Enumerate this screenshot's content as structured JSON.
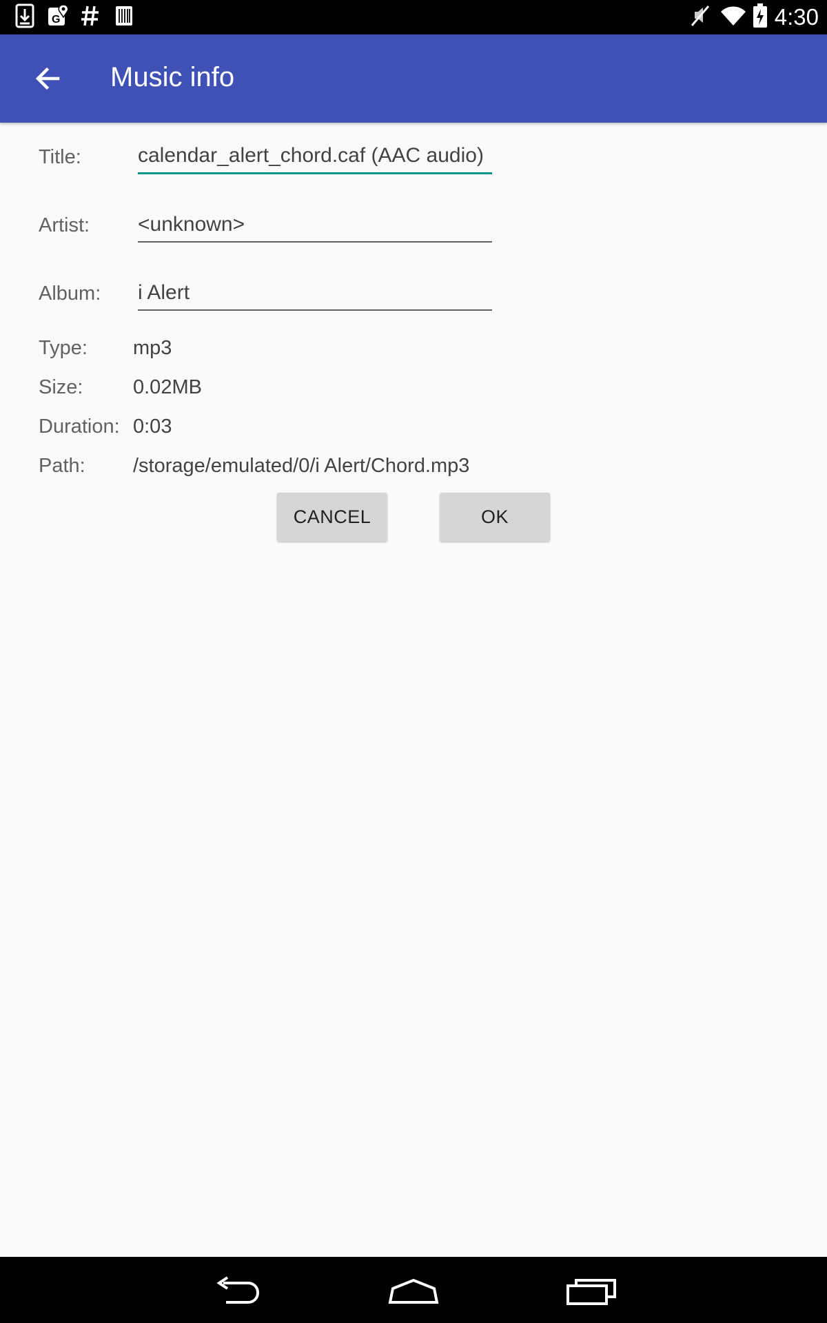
{
  "status_bar": {
    "time": "4:30",
    "left_icons": [
      "download-icon",
      "maps-icon",
      "hashtag-icon",
      "barcode-icon"
    ],
    "right_icons": [
      "mute-icon",
      "wifi-icon",
      "battery-charging-icon"
    ]
  },
  "app_bar": {
    "title": "Music info",
    "background": "#3f51b5"
  },
  "form": {
    "title": {
      "label": "Title:",
      "value": "calendar_alert_chord.caf (AAC audio)"
    },
    "artist": {
      "label": "Artist:",
      "value": "<unknown>"
    },
    "album": {
      "label": "Album:",
      "value": "i Alert"
    }
  },
  "info": {
    "type": {
      "label": "Type:",
      "value": "mp3"
    },
    "size": {
      "label": "Size:",
      "value": "0.02MB"
    },
    "duration": {
      "label": "Duration:",
      "value": "0:03"
    },
    "path": {
      "label": "Path:",
      "value": "/storage/emulated/0/i Alert/Chord.mp3"
    }
  },
  "buttons": {
    "cancel": "CANCEL",
    "ok": "OK"
  },
  "colors": {
    "accent": "#009688",
    "primary": "#3f51b5"
  }
}
